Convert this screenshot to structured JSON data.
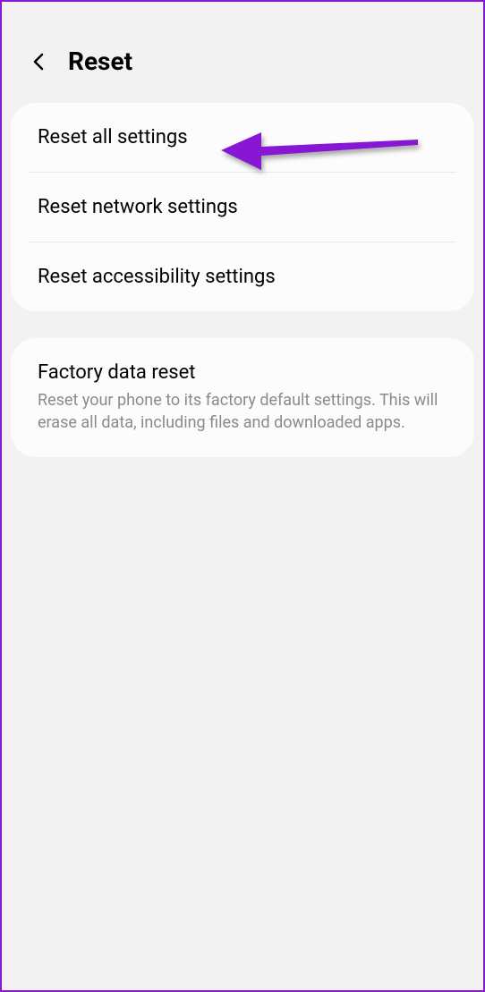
{
  "header": {
    "title": "Reset"
  },
  "group1": {
    "items": [
      {
        "title": "Reset all settings"
      },
      {
        "title": "Reset network settings"
      },
      {
        "title": "Reset accessibility settings"
      }
    ]
  },
  "group2": {
    "items": [
      {
        "title": "Factory data reset",
        "description": "Reset your phone to its factory default settings. This will erase all data, including files and downloaded apps."
      }
    ]
  }
}
